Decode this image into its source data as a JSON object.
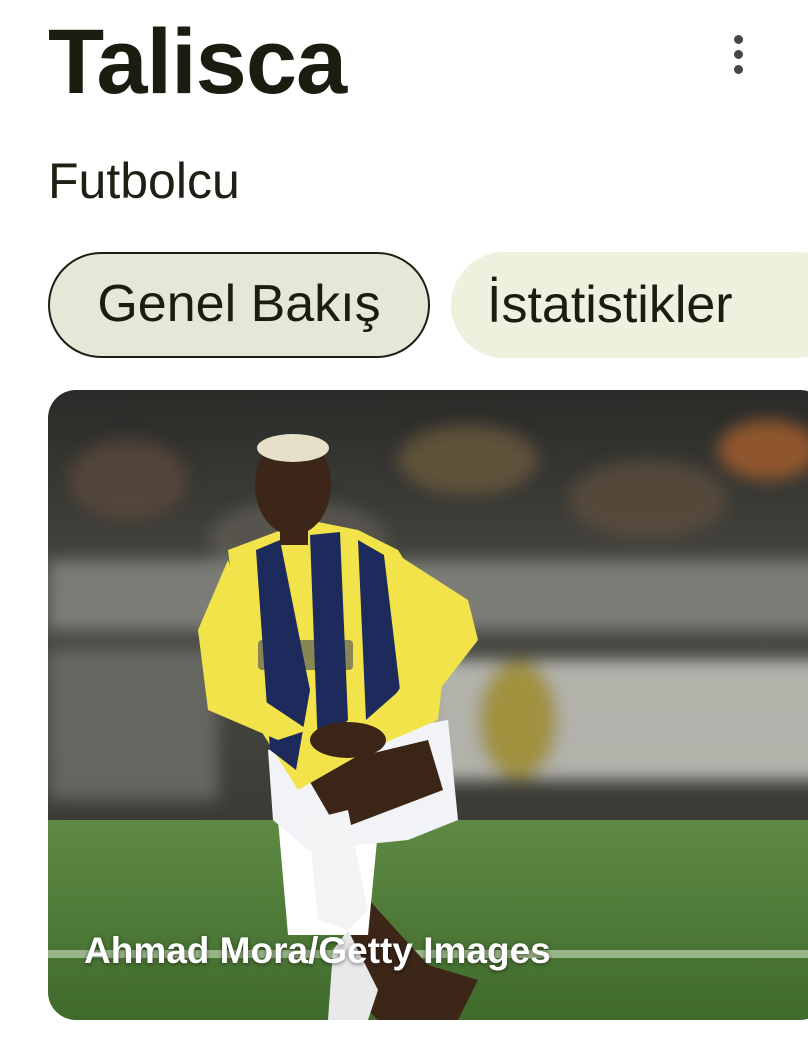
{
  "header": {
    "title": "Talisca",
    "subtitle": "Futbolcu",
    "more_icon": "more-vert-icon"
  },
  "tabs": [
    {
      "label": "Genel Bakış",
      "selected": true
    },
    {
      "label": "İstatistikler",
      "selected": false
    }
  ],
  "image": {
    "credit": "Ahmad Mora/Getty Images"
  },
  "colors": {
    "selected_tab_bg": "#e5e8d6",
    "tab_bg": "#eff1df",
    "jersey_yellow": "#f2e34a",
    "jersey_navy": "#1d2a5c",
    "pitch_green": "#4f7a3a"
  }
}
